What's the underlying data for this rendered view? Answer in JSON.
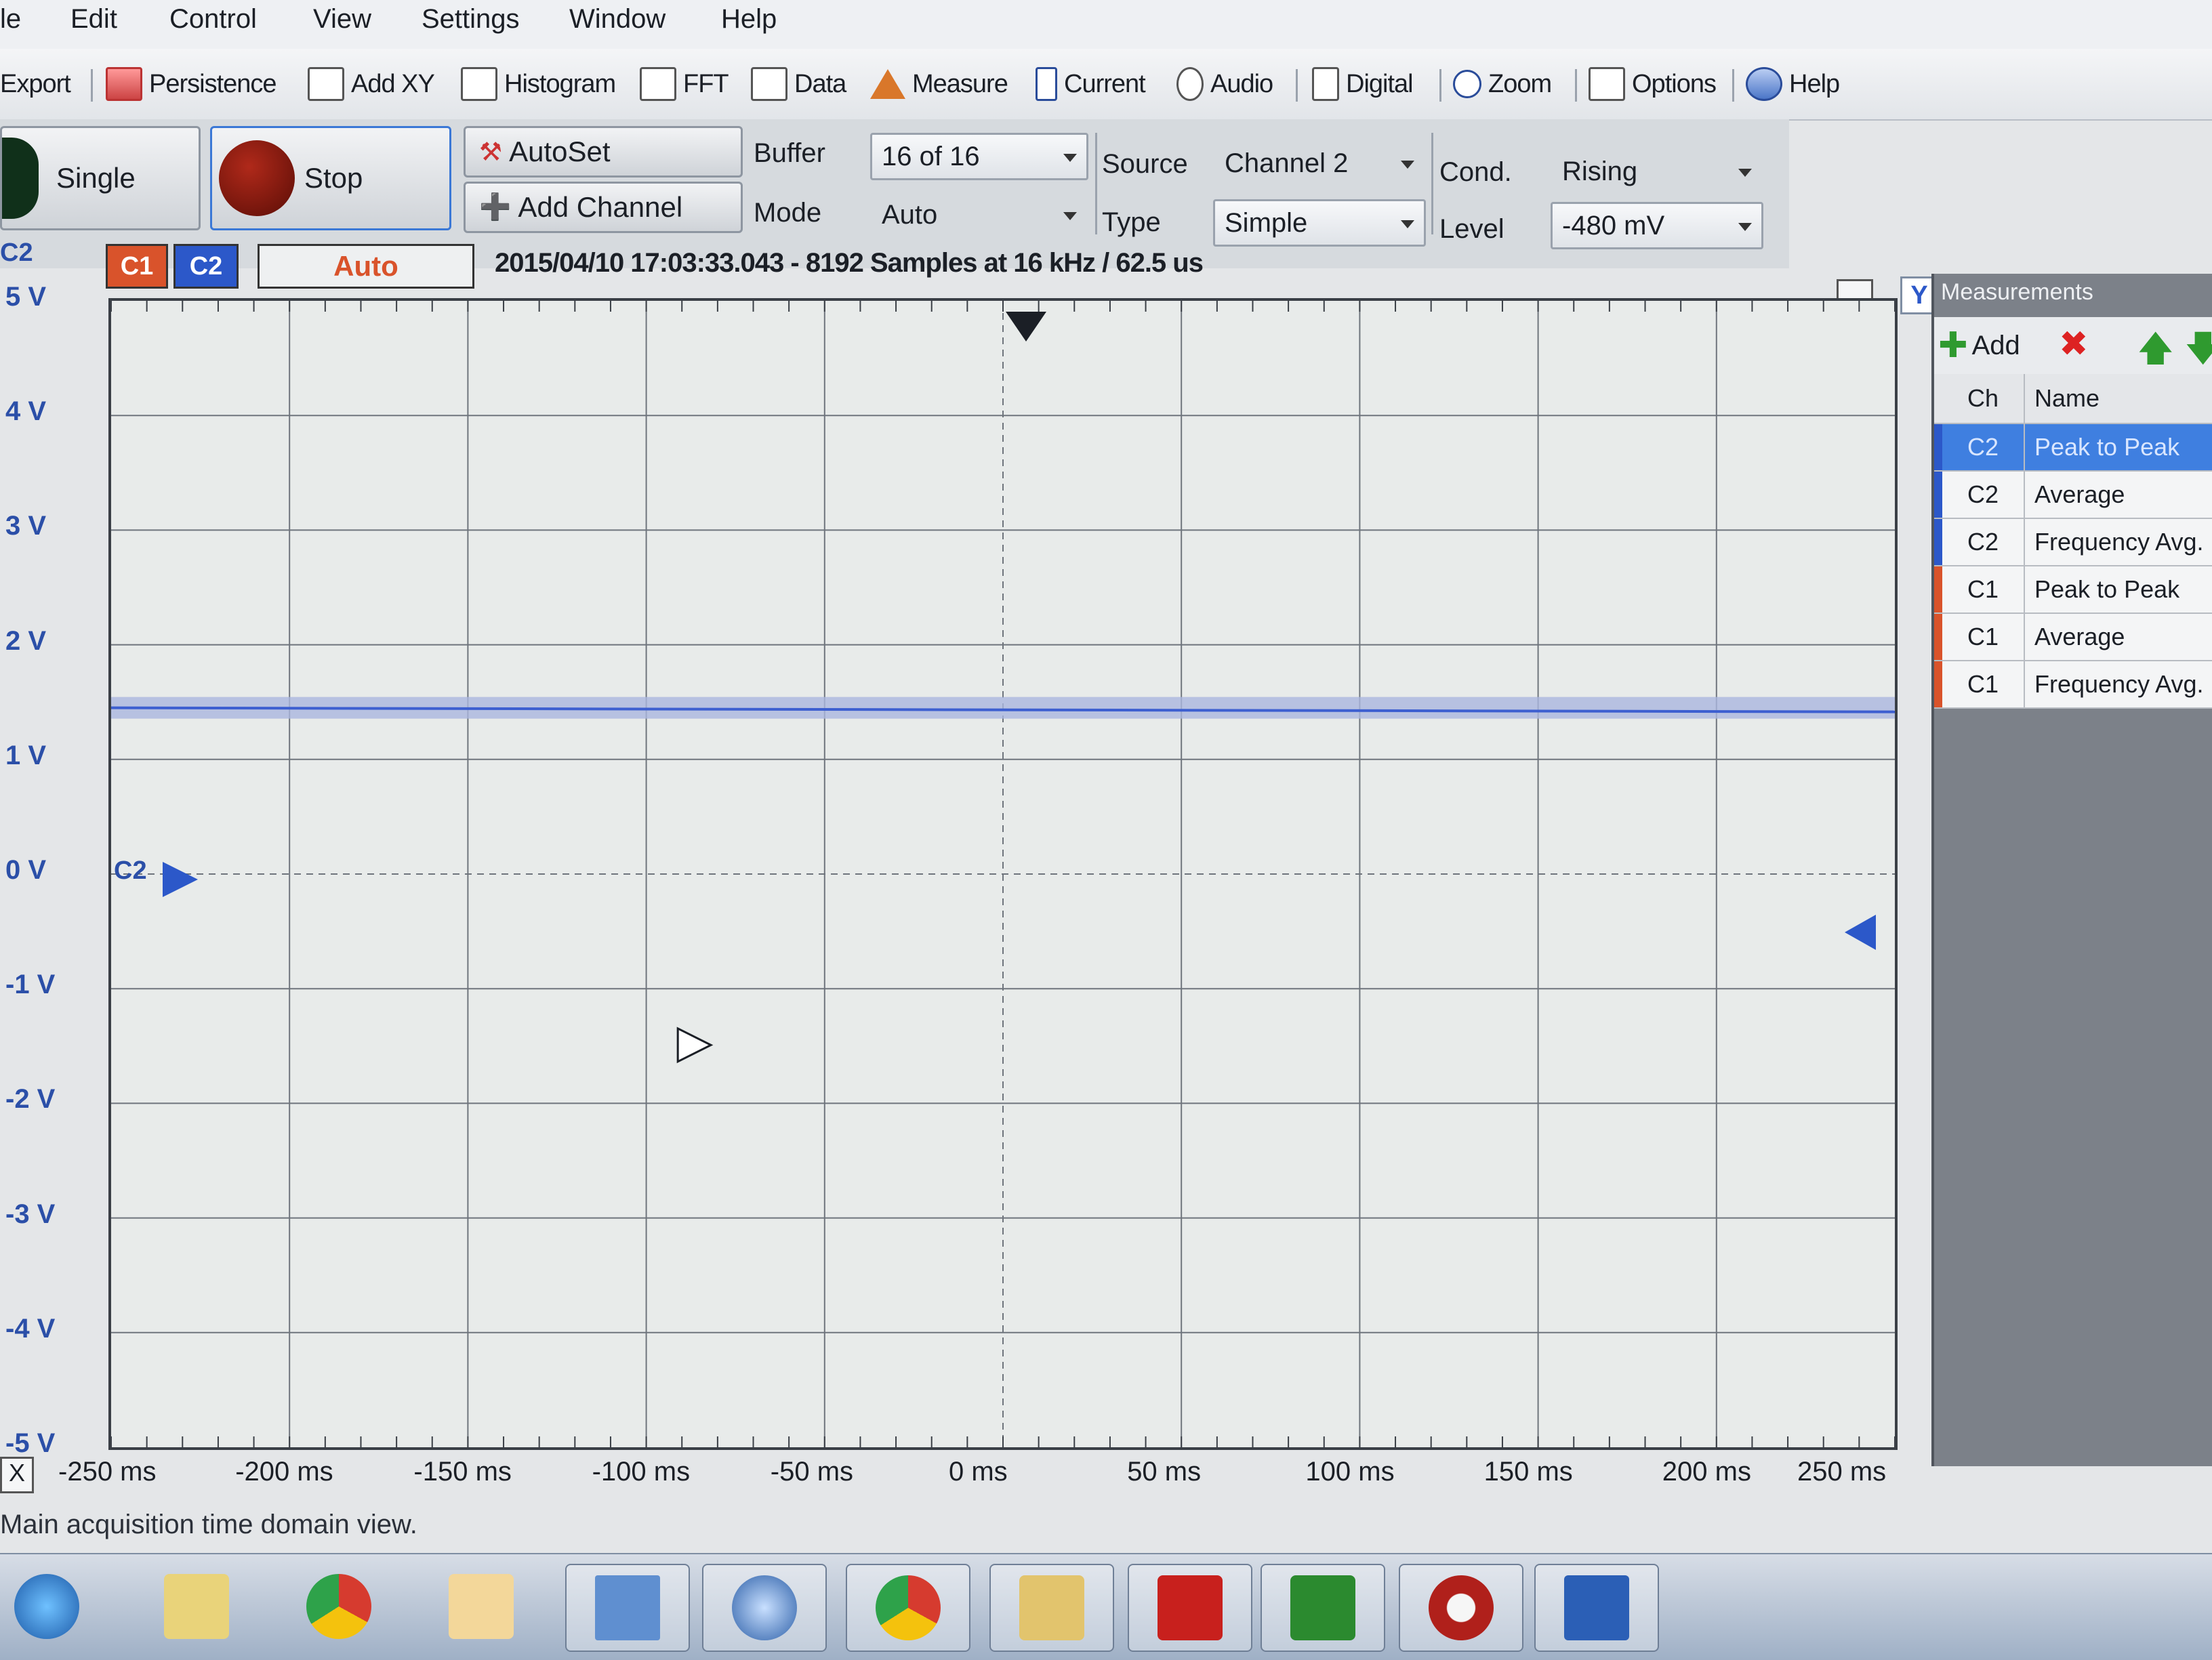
{
  "menu": [
    "le",
    "Edit",
    "Control",
    "View",
    "Settings",
    "Window",
    "Help"
  ],
  "toolbar": {
    "export": "Export",
    "persistence": "Persistence",
    "add_xy": "Add XY",
    "histogram": "Histogram",
    "fft": "FFT",
    "data": "Data",
    "measure": "Measure",
    "current": "Current",
    "audio": "Audio",
    "digital": "Digital",
    "zoom": "Zoom",
    "options": "Options",
    "help": "Help"
  },
  "controls": {
    "single": "Single",
    "stop": "Stop",
    "autoset": "AutoSet",
    "add_channel": "Add Channel",
    "buffer_label": "Buffer",
    "buffer_value": "16 of 16",
    "mode_label": "Mode",
    "mode_value": "Auto",
    "source_label": "Source",
    "source_value": "Channel 2",
    "type_label": "Type",
    "type_value": "Simple",
    "cond_label": "Cond.",
    "cond_value": "Rising",
    "level_label": "Level",
    "level_value": "-480 mV"
  },
  "scope": {
    "channel_prefix": "C2",
    "c1": "C1",
    "c2": "C2",
    "trigger_status": "Auto",
    "info": "2015/04/10 17:03:33.043 - 8192 Samples at 16 kHz / 62.5 us",
    "y_button": "Y",
    "x_button": "X",
    "c2_marker": "C2",
    "y_ticks": [
      "5 V",
      "4 V",
      "3 V",
      "2 V",
      "1 V",
      "0 V",
      "-1 V",
      "-2 V",
      "-3 V",
      "-4 V",
      "-5 V"
    ],
    "x_ticks": [
      "-250 ms",
      "-200 ms",
      "-150 ms",
      "-100 ms",
      "-50 ms",
      "0 ms",
      "50 ms",
      "100 ms",
      "150 ms",
      "200 ms",
      "250 ms"
    ],
    "trace_level_v": 1.45,
    "colors": {
      "c1": "#d9532b",
      "c2": "#2c58c9",
      "trace": "#3d5fd0",
      "trace_band": "#aab6de"
    }
  },
  "measurements": {
    "title": "Measurements",
    "add": "Add",
    "headers": [
      "Ch",
      "Name"
    ],
    "rows": [
      {
        "ch": "C2",
        "name": "Peak to Peak",
        "selected": true
      },
      {
        "ch": "C2",
        "name": "Average"
      },
      {
        "ch": "C2",
        "name": "Frequency Avg."
      },
      {
        "ch": "C1",
        "name": "Peak to Peak"
      },
      {
        "ch": "C1",
        "name": "Average"
      },
      {
        "ch": "C1",
        "name": "Frequency Avg."
      }
    ]
  },
  "status": "Main acquisition time domain view.",
  "taskbar": [
    "start-icon",
    "file-explorer-icon",
    "chrome-icon",
    "email-icon",
    "capture-icon",
    "thunderbird-icon",
    "chrome-icon",
    "folder-icon",
    "acrobat-icon",
    "waveforms-icon",
    "mplab-icon",
    "word-icon"
  ]
}
